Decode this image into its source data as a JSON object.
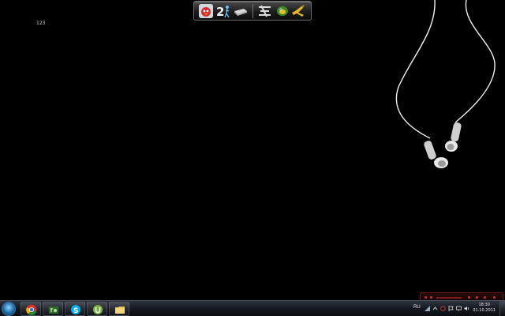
{
  "desktop": {
    "icon_label": "123"
  },
  "dock": {
    "items": [
      "angry-birds-icon",
      "portal-2-icon",
      "drive-icon",
      "tool-icon",
      "fish-icon",
      "horn-icon"
    ]
  },
  "taskbar": {
    "pinned": [
      "chrome-icon",
      "game-app-icon",
      "skype-icon",
      "utorrent-icon",
      "file-explorer-icon"
    ],
    "tray": {
      "language": "RU",
      "time": "18:30",
      "date": "01.10.2011"
    }
  },
  "colors": {
    "accent": "#1b6aa8",
    "player": "#c42b2b"
  }
}
